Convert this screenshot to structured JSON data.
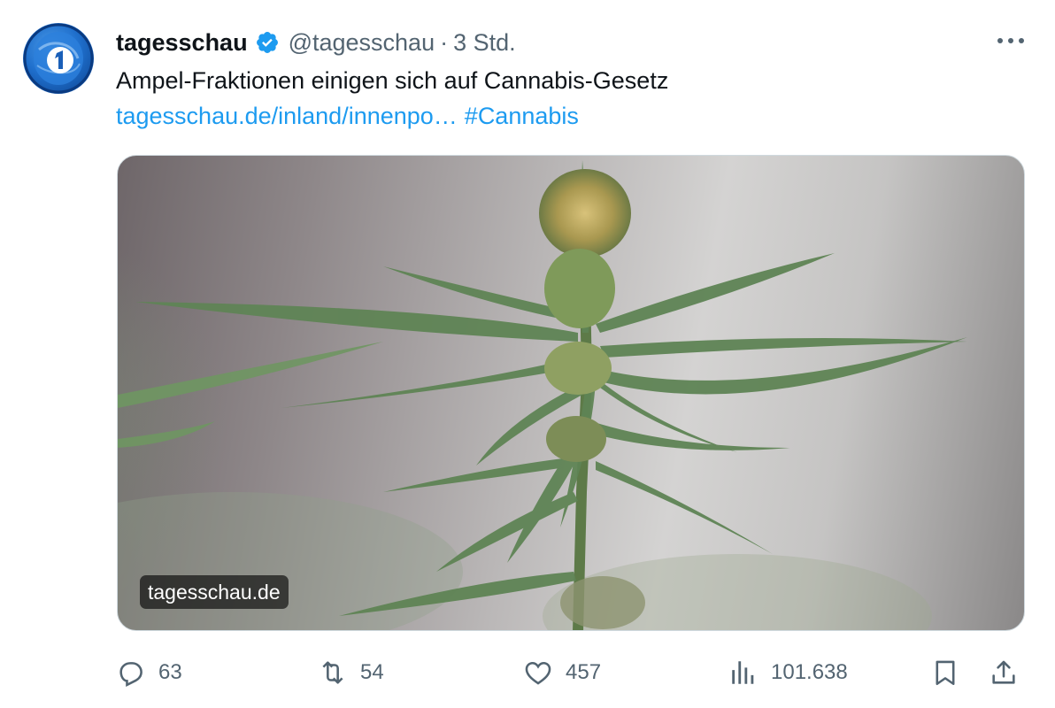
{
  "tweet": {
    "author_name": "tagesschau",
    "handle": "@tagesschau",
    "separator": "·",
    "time": "3 Std.",
    "text": "Ampel-Fraktionen einigen sich auf Cannabis-Gesetz",
    "link_text": "tagesschau.de/inland/innenpo…",
    "hashtag": "#Cannabis"
  },
  "media": {
    "domain_label": "tagesschau.de"
  },
  "actions": {
    "replies": "63",
    "retweets": "54",
    "likes": "457",
    "views": "101.638"
  },
  "icons": {
    "avatar": "tagesschau-logo-icon",
    "verified": "verified-badge-icon",
    "more": "more-icon",
    "reply": "reply-icon",
    "retweet": "retweet-icon",
    "like": "heart-icon",
    "views": "views-chart-icon",
    "bookmark": "bookmark-icon",
    "share": "share-icon"
  },
  "colors": {
    "link": "#1d9bf0",
    "secondary_text": "#536471",
    "primary_text": "#0f1419",
    "verified": "#1d9bf0"
  }
}
